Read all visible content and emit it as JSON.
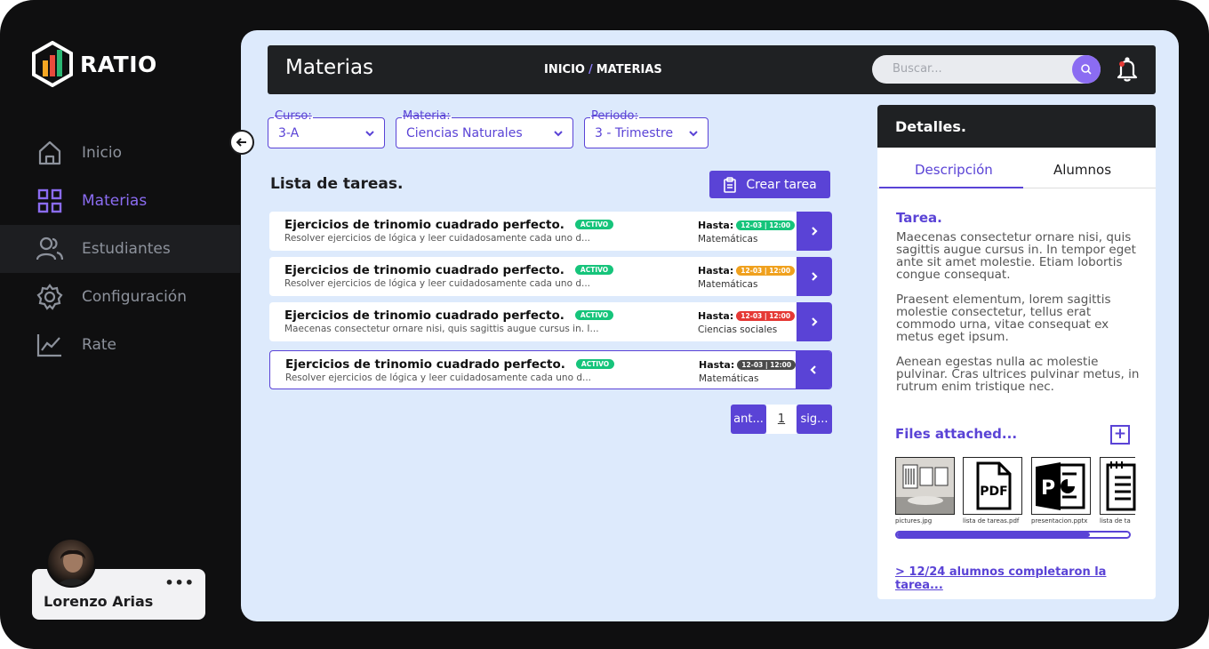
{
  "brand": {
    "name": "RATIO",
    "accent": "#5a43d6",
    "accent_light": "#8b6cf2"
  },
  "sidebar": {
    "items": [
      {
        "label": "Inicio",
        "icon": "home-icon"
      },
      {
        "label": "Materias",
        "icon": "grid-icon"
      },
      {
        "label": "Estudiantes",
        "icon": "users-icon"
      },
      {
        "label": "Configuración",
        "icon": "gear-icon"
      },
      {
        "label": "Rate",
        "icon": "chart-line-icon"
      }
    ],
    "active_index": 1,
    "hover_index": 2
  },
  "user": {
    "name": "Lorenzo Arias",
    "more": "•••"
  },
  "header": {
    "title": "Materias",
    "breadcrumb": {
      "home": "INICIO",
      "separator": "/",
      "current": "MATERIAS"
    },
    "search_placeholder": "Buscar..."
  },
  "filters": [
    {
      "label": "Curso:",
      "value": "3-A"
    },
    {
      "label": "Materia:",
      "value": "Ciencias Naturales"
    },
    {
      "label": "Periodo:",
      "value": "3 - Trimestre"
    }
  ],
  "tasks_section": {
    "title": "Lista de tareas.",
    "create_label": "Crear tarea"
  },
  "tasks": [
    {
      "title": "Ejercicios de trinomio cuadrado perfecto.",
      "status": "ACTIVO",
      "description": "Resolver ejercicios de lógica y leer cuidadosamente cada uno d...",
      "due_label": "Hasta:",
      "due": "12-03 | 12:00",
      "due_color": "#16c47b",
      "subject": "Matemáticas"
    },
    {
      "title": "Ejercicios de trinomio cuadrado perfecto.",
      "status": "ACTIVO",
      "description": "Resolver ejercicios de lógica y leer cuidadosamente cada uno d...",
      "due_label": "Hasta:",
      "due": "12-03 | 12:00",
      "due_color": "#f0a11e",
      "subject": "Matemáticas"
    },
    {
      "title": "Ejercicios de trinomio cuadrado perfecto.",
      "status": "ACTIVO",
      "description": "Maecenas consectetur ornare nisi, quis sagittis augue cursus in. I...",
      "due_label": "Hasta:",
      "due": "12-03 | 12:00",
      "due_color": "#e53935",
      "subject": "Ciencias sociales"
    },
    {
      "title": "Ejercicios de trinomio cuadrado perfecto.",
      "status": "ACTIVO",
      "description": "Resolver ejercicios de lógica y leer cuidadosamente cada uno d...",
      "due_label": "Hasta:",
      "due": "12-03 | 12:00",
      "due_color": "#4a4a4a",
      "subject": "Matemáticas"
    }
  ],
  "pagination": {
    "prev": "ant...",
    "page": "1",
    "next": "sig..."
  },
  "details": {
    "title": "Detalles.",
    "tabs": [
      "Descripción",
      "Alumnos"
    ],
    "section_title": "Tarea.",
    "paragraphs": [
      "Maecenas consectetur ornare nisi, quis sagittis augue cursus in. In tempor eget ante sit amet molestie. Etiam lobortis congue consequat.",
      "Praesent elementum, lorem sagittis molestie consectetur, tellus erat commodo urna, vitae consequat ex metus eget ipsum.",
      "Aenean egestas nulla ac molestie pulvinar. Cras ultrices pulvinar metus, in rutrum enim tristique nec."
    ],
    "files_title": "Files attached...",
    "files_add": "+",
    "files": [
      {
        "name": "pictures.jpg",
        "icon": "image-icon"
      },
      {
        "name": "lista de tareas.pdf",
        "icon": "pdf-icon"
      },
      {
        "name": "presentacion.pptx",
        "icon": "pptx-icon"
      },
      {
        "name": "lista de ta...",
        "icon": "document-icon"
      }
    ],
    "scroll_progress": 0.83,
    "completed_link": "> 12/24 alumnos completaron la tarea..."
  }
}
